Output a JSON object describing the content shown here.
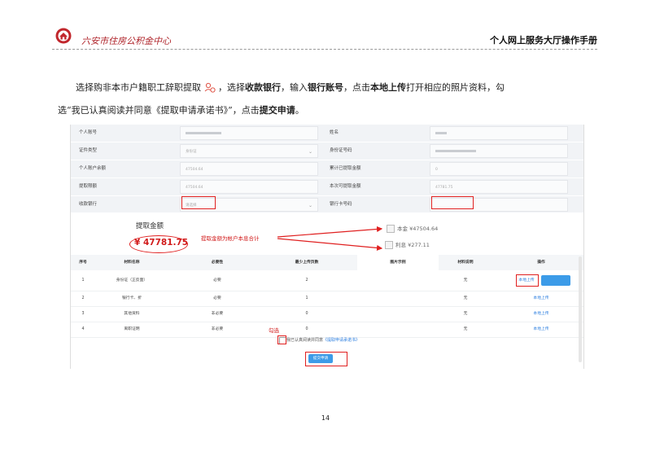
{
  "header": {
    "org_name": "六安市住房公积金中心",
    "manual_title": "个人网上服务大厅操作手册"
  },
  "instruction": {
    "t1": "选择购非本市户籍职工辞职提取",
    "t2": "，选择",
    "b1": "收款银行",
    "t3": "，输入",
    "b2": "银行账号",
    "t4": "，点击",
    "b3": "本地上传",
    "t5": "打开相应的照片资料，勾",
    "t6": "选“我已认真阅读并同意《提取申请承诺书》”，点击",
    "b4": "提交申请",
    "t7": "。"
  },
  "form": {
    "rows": [
      {
        "l1": "个人账号",
        "v1": "",
        "l2": "姓名",
        "v2": ""
      },
      {
        "l1": "证件类型",
        "v1": "身份证",
        "l2": "身份证号码",
        "v2": ""
      },
      {
        "l1": "个人账户余额",
        "v1": "47504.64",
        "l2": "累计已提取金额",
        "v2": "0"
      },
      {
        "l1": "提取限额",
        "v1": "47504.64",
        "l2": "本次可提取金额",
        "v2": "47781.75"
      },
      {
        "l1": "收款银行",
        "v1": "请选择",
        "l2": "银行卡号码",
        "v2": ""
      }
    ]
  },
  "amount": {
    "title": "提取金额",
    "value": "¥ 47781.75",
    "principal": "本金 ¥47504.64",
    "interest": "利息 ¥277.11",
    "annotation": "提取金额为帐户本息合计"
  },
  "table": {
    "headers": [
      "序号",
      "材料名称",
      "必要性",
      "最少上传页数",
      "图片示例",
      "材料说明",
      "操作"
    ],
    "rows": [
      {
        "no": "1",
        "name": "身份证（正反面）",
        "req": "必要",
        "pages": "2",
        "note": "无",
        "op": "本地上传"
      },
      {
        "no": "2",
        "name": "银行卡、折",
        "req": "必要",
        "pages": "1",
        "note": "无",
        "op": "本地上传"
      },
      {
        "no": "3",
        "name": "其他资料",
        "req": "非必要",
        "pages": "0",
        "note": "无",
        "op": "本地上传"
      },
      {
        "no": "4",
        "name": "离职证明",
        "req": "非必要",
        "pages": "0",
        "note": "无",
        "op": "本地上传"
      }
    ]
  },
  "agree": {
    "check_note": "勾选",
    "text": "我已认真阅读并同意",
    "link": "《提取申请承诺书》",
    "submit": "提交申请"
  },
  "page_number": "14",
  "colors": {
    "brand": "#b0262c",
    "annotation": "#e02020",
    "link": "#2d7fe0",
    "button": "#3c9be8"
  }
}
